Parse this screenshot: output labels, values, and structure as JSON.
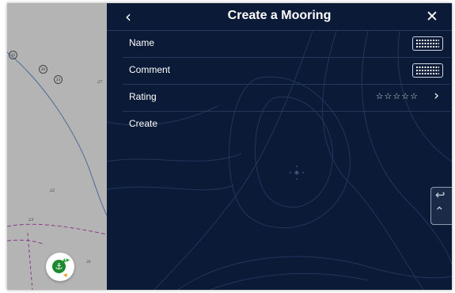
{
  "header": {
    "title": "Create a Mooring",
    "back_icon": "chevron-left-icon",
    "close_icon": "close-icon"
  },
  "form": {
    "rows": [
      {
        "label": "Name",
        "action_icon": "keyboard-icon"
      },
      {
        "label": "Comment",
        "action_icon": "keyboard-icon"
      },
      {
        "label": "Rating",
        "value": "☆☆☆☆☆",
        "action_icon": "chevron-right-icon"
      },
      {
        "label": "Create"
      }
    ]
  },
  "chart": {
    "depth_labels": [
      "15",
      "20",
      "23",
      "27",
      "22",
      "23",
      "31"
    ],
    "anchor_button_icon": "anchor-icon"
  },
  "side_tab": {
    "icons": [
      "undo-arrow-icon",
      "expand-up-icon"
    ]
  },
  "colors": {
    "panel_background": "#0b1a36",
    "map_background": "#b4b4b4",
    "anchor_green": "#1b8a2e",
    "text": "#ffffff"
  }
}
